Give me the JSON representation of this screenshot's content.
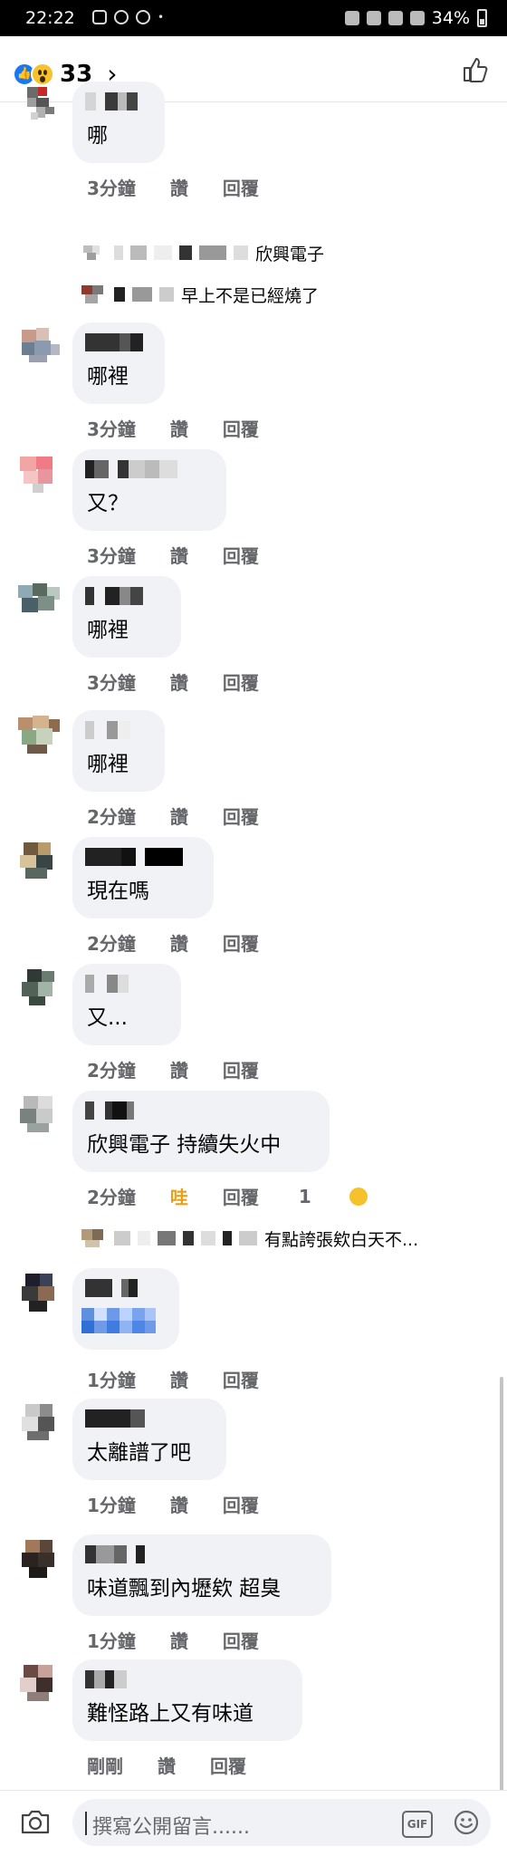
{
  "status": {
    "time": "22:22",
    "battery": "34%"
  },
  "header": {
    "reaction_count": "33",
    "chevron": "›"
  },
  "comments": [
    {
      "text": "哪",
      "time": "3分鐘",
      "like": "讚",
      "reply": "回覆"
    },
    {
      "text": "哪裡",
      "time": "3分鐘",
      "like": "讚",
      "reply": "回覆"
    },
    {
      "text": "又？",
      "time": "3分鐘",
      "like": "讚",
      "reply": "回覆"
    },
    {
      "text": "哪裡",
      "time": "3分鐘",
      "like": "讚",
      "reply": "回覆"
    },
    {
      "text": "哪裡",
      "time": "2分鐘",
      "like": "讚",
      "reply": "回覆"
    },
    {
      "text": "現在嗎",
      "time": "2分鐘",
      "like": "讚",
      "reply": "回覆"
    },
    {
      "text": "又...",
      "time": "2分鐘",
      "like": "讚",
      "reply": "回覆"
    },
    {
      "text": "欣興電子 持續失火中",
      "time": "2分鐘",
      "like": "哇",
      "reply": "回覆",
      "reaction_count": "1"
    },
    {
      "text": "",
      "time": "1分鐘",
      "like": "讚",
      "reply": "回覆"
    },
    {
      "text": "太離譜了吧",
      "time": "1分鐘",
      "like": "讚",
      "reply": "回覆"
    },
    {
      "text": "味道飄到內壢欸 超臭",
      "time": "1分鐘",
      "like": "讚",
      "reply": "回覆"
    },
    {
      "text": "難怪路上又有味道",
      "time": "剛剛",
      "like": "讚",
      "reply": "回覆"
    }
  ],
  "replies": [
    {
      "text": "欣興電子"
    },
    {
      "text": "早上不是已經燒了"
    },
    {
      "text": "有點誇張欸白天不..."
    }
  ],
  "composer": {
    "placeholder": "撰寫公開留言......",
    "gif_label": "GIF"
  },
  "colors": {
    "accent": "#1877f2",
    "wow": "#f7c12b",
    "bubble": "#f0f2f5",
    "meta": "#65676b"
  }
}
